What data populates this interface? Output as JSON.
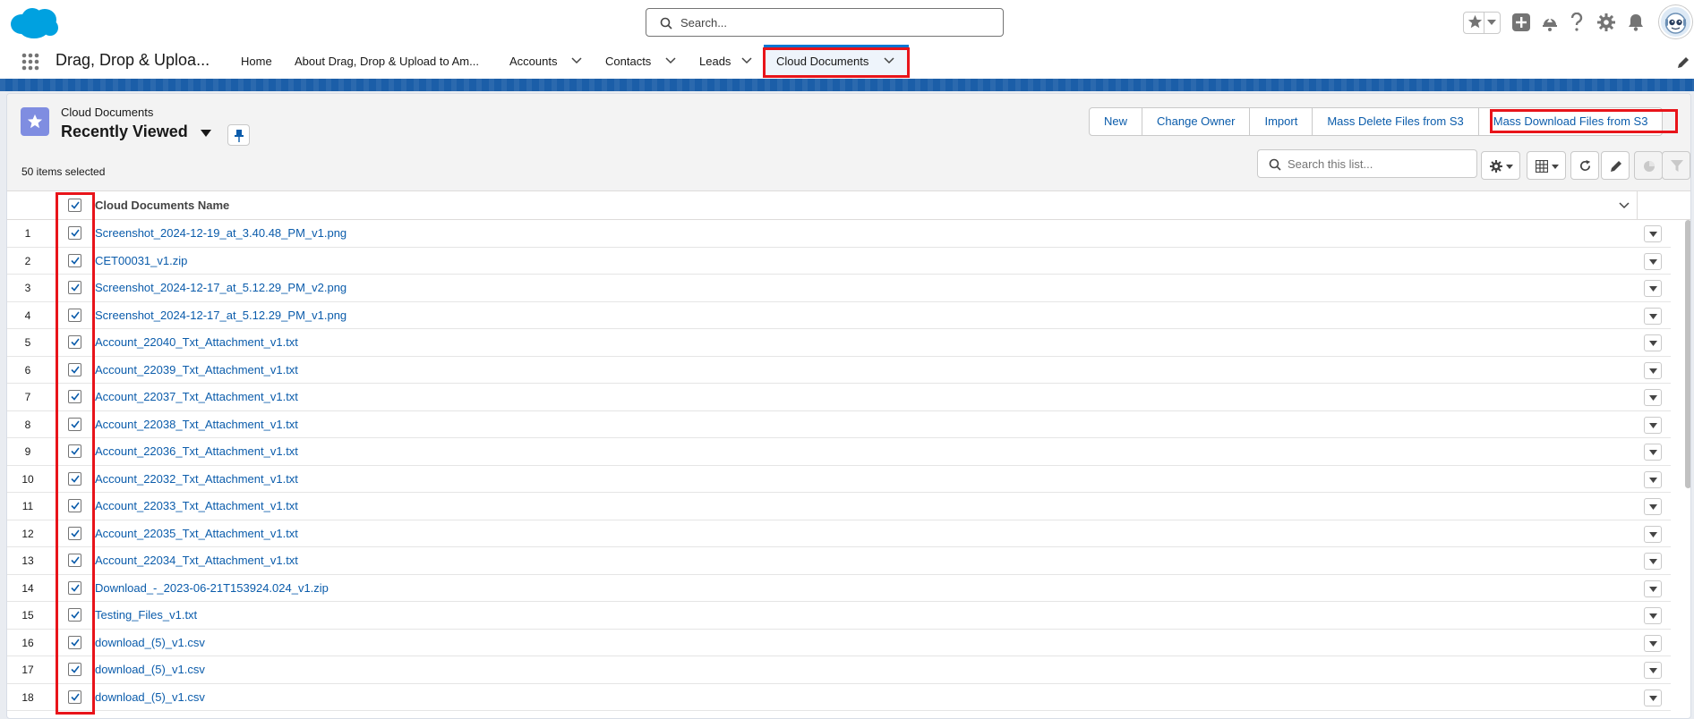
{
  "header": {
    "search_placeholder": "Search..."
  },
  "nav": {
    "app_name": "Drag, Drop & Uploa...",
    "tabs": [
      {
        "label": "Home"
      },
      {
        "label": "About Drag, Drop & Upload to Am..."
      },
      {
        "label": "Accounts"
      },
      {
        "label": "Contacts"
      },
      {
        "label": "Leads"
      },
      {
        "label": "Cloud Documents"
      }
    ]
  },
  "list": {
    "object_label": "Cloud Documents",
    "view_name": "Recently Viewed",
    "selected_count": "50 items selected",
    "search_placeholder": "Search this list...",
    "actions": [
      "New",
      "Change Owner",
      "Import",
      "Mass Delete Files from S3",
      "Mass Download Files from S3"
    ],
    "column_header": "Cloud Documents Name",
    "rows": [
      {
        "num": "1",
        "name": "Screenshot_2024-12-19_at_3.40.48_PM_v1.png"
      },
      {
        "num": "2",
        "name": "CET00031_v1.zip"
      },
      {
        "num": "3",
        "name": "Screenshot_2024-12-17_at_5.12.29_PM_v2.png"
      },
      {
        "num": "4",
        "name": "Screenshot_2024-12-17_at_5.12.29_PM_v1.png"
      },
      {
        "num": "5",
        "name": "Account_22040_Txt_Attachment_v1.txt"
      },
      {
        "num": "6",
        "name": "Account_22039_Txt_Attachment_v1.txt"
      },
      {
        "num": "7",
        "name": "Account_22037_Txt_Attachment_v1.txt"
      },
      {
        "num": "8",
        "name": "Account_22038_Txt_Attachment_v1.txt"
      },
      {
        "num": "9",
        "name": "Account_22036_Txt_Attachment_v1.txt"
      },
      {
        "num": "10",
        "name": "Account_22032_Txt_Attachment_v1.txt"
      },
      {
        "num": "11",
        "name": "Account_22033_Txt_Attachment_v1.txt"
      },
      {
        "num": "12",
        "name": "Account_22035_Txt_Attachment_v1.txt"
      },
      {
        "num": "13",
        "name": "Account_22034_Txt_Attachment_v1.txt"
      },
      {
        "num": "14",
        "name": "Download_-_2023-06-21T153924.024_v1.zip"
      },
      {
        "num": "15",
        "name": "Testing_Files_v1.txt"
      },
      {
        "num": "16",
        "name": "download_(5)_v1.csv"
      },
      {
        "num": "17",
        "name": "download_(5)_v1.csv"
      },
      {
        "num": "18",
        "name": "download_(5)_v1.csv"
      }
    ]
  },
  "colors": {
    "brand_blue": "#0176d3",
    "link_blue": "#0b5cab",
    "highlight_red": "#e8141a",
    "band_blue": "#1b5ea8",
    "object_icon": "#7f8de1"
  },
  "icons": [
    "salesforce-cloud-logo",
    "search-icon",
    "star-icon",
    "add-icon",
    "trailhead-icon",
    "help-icon",
    "setup-gear-icon",
    "notification-bell-icon",
    "avatar",
    "app-launcher-icon",
    "chevron-down-icon",
    "edit-pencil-icon",
    "pin-icon",
    "settings-gear-icon",
    "table-view-icon",
    "refresh-icon",
    "chart-icon",
    "filter-icon",
    "checkbox-checked"
  ]
}
